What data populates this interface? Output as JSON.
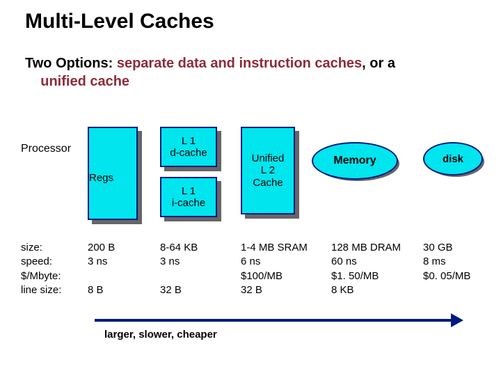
{
  "title": "Multi-Level Caches",
  "subtitle_parts": {
    "p1": "Two Options: ",
    "hl1": "separate data and instruction caches",
    "p2": ", or a ",
    "hl2": "unified cache",
    "indent_cont": "    "
  },
  "labels": {
    "processor": "Processor",
    "regs": "Regs",
    "l1d": "L 1\nd-cache",
    "l1i": "L 1\ni-cache",
    "l2": "Unified\nL 2\nCache",
    "memory": "Memory",
    "disk": "disk"
  },
  "rows": {
    "size": "size:",
    "speed": "speed:",
    "cost": "$/Mbyte:",
    "line": "line size:"
  },
  "cols": {
    "regs": {
      "size": "200 B",
      "speed": "3 ns",
      "cost": "",
      "line": "8 B"
    },
    "l1": {
      "size": "8-64 KB",
      "speed": "3  ns",
      "cost": "",
      "line": "32 B"
    },
    "l2": {
      "size": "1-4 MB SRAM",
      "speed": "6 ns",
      "cost": "$100/MB",
      "line": "32 B"
    },
    "mem": {
      "size": "128 MB DRAM",
      "speed": "60 ns",
      "cost": "$1. 50/MB",
      "line": "8  KB"
    },
    "disk": {
      "size": "30 GB",
      "speed": "8 ms",
      "cost": "$0. 05/MB",
      "line": ""
    }
  },
  "arrow_caption": "larger, slower, cheaper",
  "chart_data": {
    "type": "table",
    "title": "Memory hierarchy characteristics",
    "columns": [
      "Regs",
      "L1 cache",
      "Unified L2 Cache",
      "Memory",
      "Disk"
    ],
    "rows": [
      {
        "metric": "size",
        "values": [
          "200 B",
          "8-64 KB",
          "1-4 MB SRAM",
          "128 MB DRAM",
          "30 GB"
        ]
      },
      {
        "metric": "speed",
        "values": [
          "3 ns",
          "3 ns",
          "6 ns",
          "60 ns",
          "8 ms"
        ]
      },
      {
        "metric": "$/Mbyte",
        "values": [
          "",
          "",
          "$100/MB",
          "$1.50/MB",
          "$0.05/MB"
        ]
      },
      {
        "metric": "line size",
        "values": [
          "8 B",
          "32 B",
          "32 B",
          "8 KB",
          ""
        ]
      }
    ],
    "annotation": "larger, slower, cheaper →"
  }
}
